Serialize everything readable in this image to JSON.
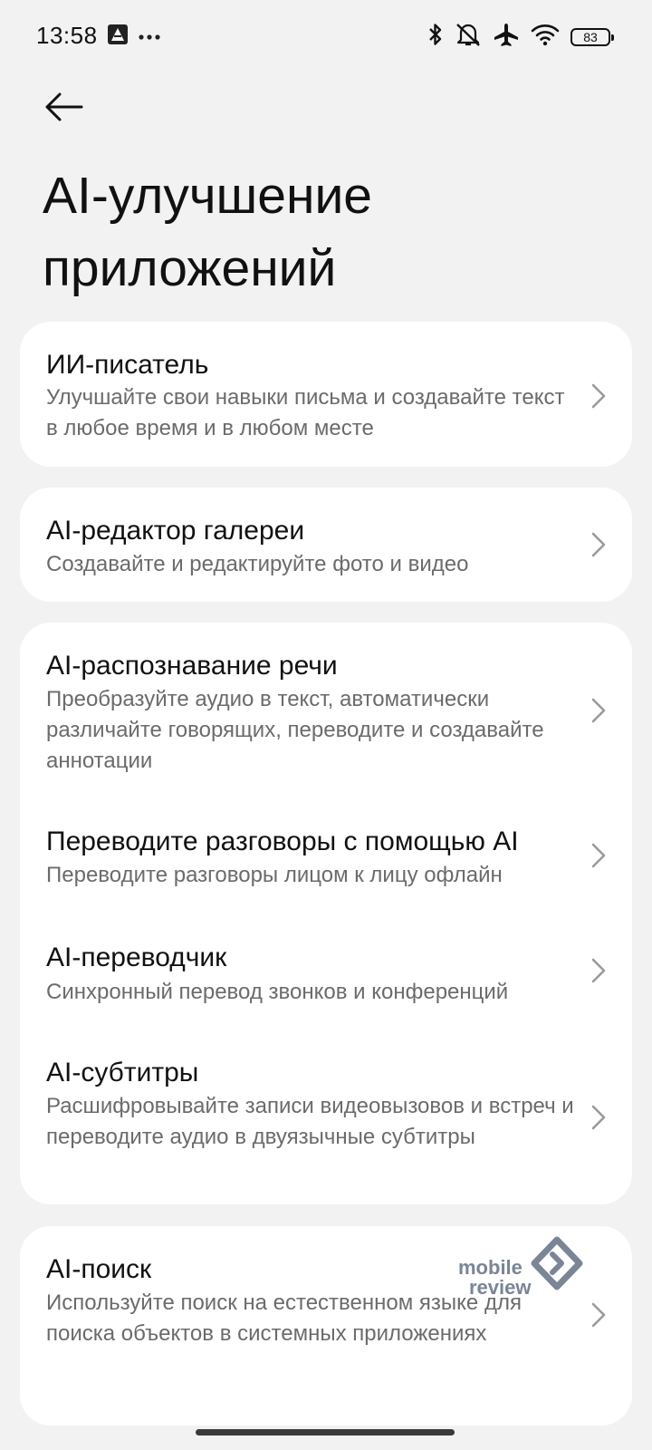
{
  "status_bar": {
    "time": "13:58",
    "left_icons": [
      "app-notification-icon",
      "more-dots-icon"
    ],
    "right_icons": [
      "bluetooth-icon",
      "mute-icon",
      "airplane-mode-icon",
      "wifi-icon"
    ],
    "battery": "83"
  },
  "header": {
    "back_icon": "arrow-left-icon",
    "title": "AI-улучшение приложений"
  },
  "items": [
    {
      "title": "ИИ-писатель",
      "desc": "Улучшайте свои навыки письма и создавайте текст в любое время и в любом месте"
    },
    {
      "title": "AI-редактор галереи",
      "desc": "Создавайте и редактируйте фото и видео"
    },
    {
      "title": "AI-распознавание речи",
      "desc": "Преобразуйте аудио в текст, автоматически различайте говорящих, переводите и создавайте аннотации"
    },
    {
      "title": "Переводите разговоры с помощью AI",
      "desc": "Переводите разговоры лицом к лицу офлайн"
    },
    {
      "title": "AI-переводчик",
      "desc": "Синхронный перевод звонков и конференций"
    },
    {
      "title": "AI-субтитры",
      "desc": "Расшифровывайте записи видеовызовов и встреч и переводите аудио в двуязычные субтитры"
    },
    {
      "title": "AI-поиск",
      "desc": "Используйте поиск на естественном языке для поиска объектов в системных приложениях"
    }
  ],
  "watermark": {
    "line1": "mobile",
    "line2": "review"
  },
  "colors": {
    "background": "#f2f2f2",
    "card": "#ffffff",
    "title": "#111111",
    "description": "#6b6b6b",
    "chevron": "#9a9a9a"
  }
}
